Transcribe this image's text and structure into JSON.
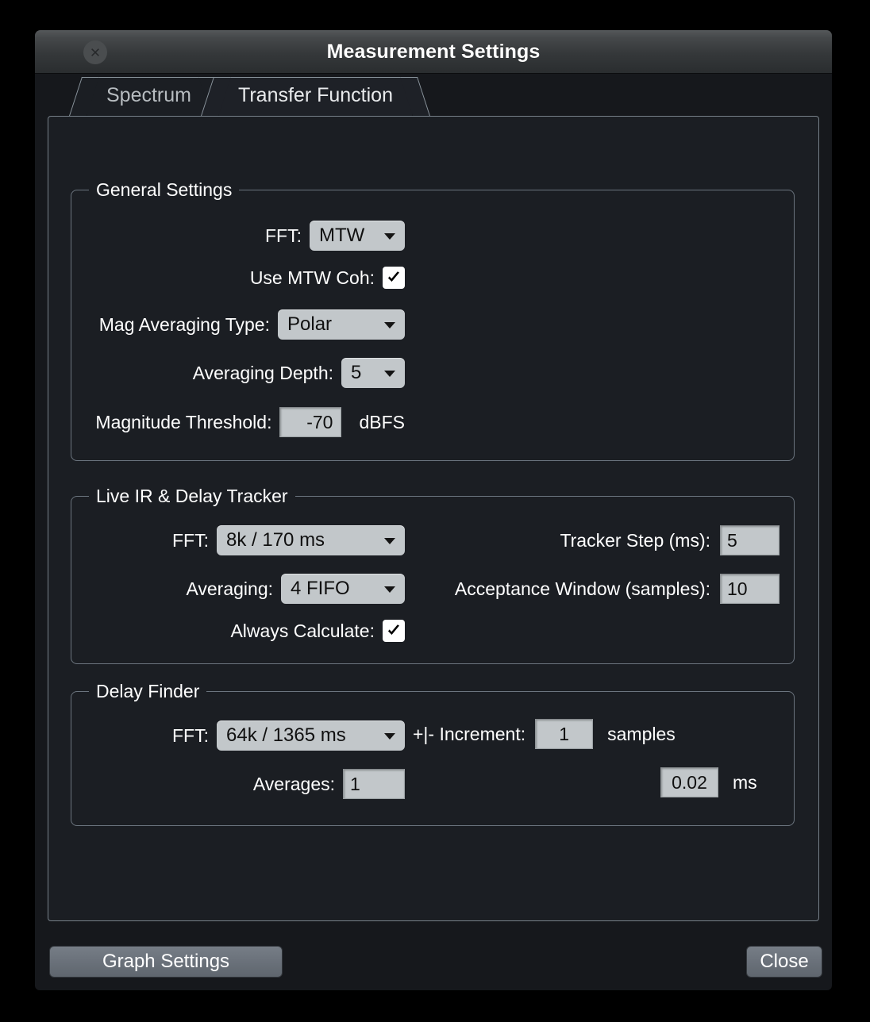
{
  "window": {
    "title": "Measurement Settings",
    "close_icon": "close-circle-icon"
  },
  "tabs": [
    {
      "label": "Spectrum",
      "active": false
    },
    {
      "label": "Transfer Function",
      "active": true
    }
  ],
  "groups": {
    "general": {
      "legend": "General Settings",
      "fft_label": "FFT:",
      "fft_value": "MTW",
      "use_mtw_coh_label": "Use MTW Coh:",
      "use_mtw_coh_checked": true,
      "mag_avg_type_label": "Mag Averaging Type:",
      "mag_avg_type_value": "Polar",
      "averaging_depth_label": "Averaging Depth:",
      "averaging_depth_value": "5",
      "magnitude_threshold_label": "Magnitude Threshold:",
      "magnitude_threshold_value": "-70",
      "magnitude_threshold_unit": "dBFS"
    },
    "live_ir": {
      "legend": "Live IR & Delay Tracker",
      "fft_label": "FFT:",
      "fft_value": "8k / 170 ms",
      "tracker_step_label": "Tracker Step (ms):",
      "tracker_step_value": "5",
      "averaging_label": "Averaging:",
      "averaging_value": "4 FIFO",
      "acceptance_window_label": "Acceptance Window (samples):",
      "acceptance_window_value": "10",
      "always_calculate_label": "Always Calculate:",
      "always_calculate_checked": true
    },
    "delay_finder": {
      "legend": "Delay Finder",
      "fft_label": "FFT:",
      "fft_value": "64k / 1365 ms",
      "increment_label": "+|- Increment:",
      "increment_value": "1",
      "increment_unit": "samples",
      "averages_label": "Averages:",
      "averages_value": "1",
      "ms_value": "0.02",
      "ms_unit": "ms"
    }
  },
  "footer": {
    "graph_settings_label": "Graph Settings",
    "close_label": "Close"
  },
  "colors": {
    "window_bg": "#16181c",
    "panel_bg": "#1b1e23",
    "group_border": "#6b747e",
    "control_face": "#c2c7ca",
    "button_face": "#6a717a",
    "text": "#ffffff"
  }
}
